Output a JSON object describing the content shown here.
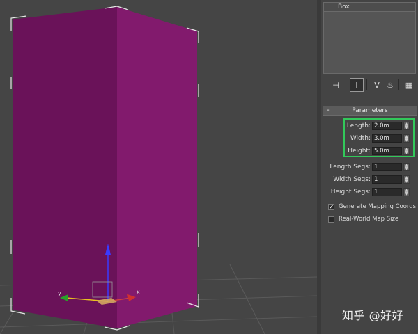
{
  "viewport": {
    "object_color": "#7e1569",
    "axis_labels": {
      "x": "x",
      "y": "y"
    }
  },
  "command_panel": {
    "object_name": "Box",
    "toolbar": {
      "icons": [
        "pin-stack-icon",
        "show-end-result-icon",
        "make-unique-icon",
        "remove-modifier-icon",
        "configure-modifier-sets-icon"
      ]
    },
    "parameters": {
      "title": "Parameters",
      "collapse_symbol": "-",
      "length": {
        "label": "Length:",
        "value": "2.0m"
      },
      "width": {
        "label": "Width:",
        "value": "3.0m"
      },
      "height": {
        "label": "Height:",
        "value": "5.0m"
      },
      "length_segs": {
        "label": "Length Segs:",
        "value": "1"
      },
      "width_segs": {
        "label": "Width Segs:",
        "value": "1"
      },
      "height_segs": {
        "label": "Height Segs:",
        "value": "1"
      },
      "generate_mapping": {
        "label": "Generate Mapping Coords.",
        "checked": true,
        "check_glyph": "✔"
      },
      "real_world_map": {
        "label": "Real-World Map Size",
        "checked": false
      }
    },
    "highlight_color": "#32c85a"
  },
  "watermark": "知乎 @好好"
}
